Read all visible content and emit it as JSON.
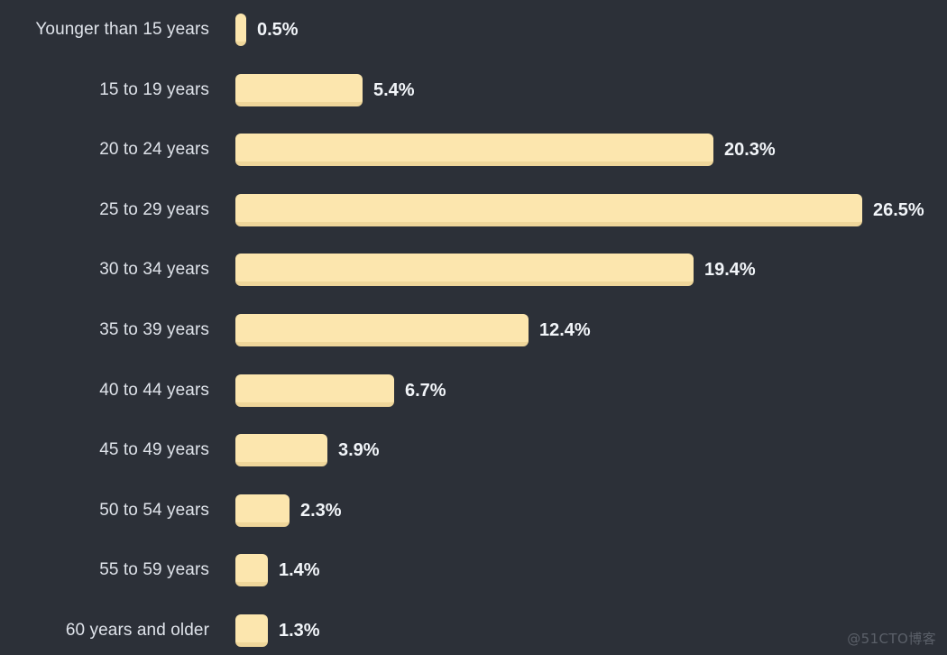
{
  "theme": {
    "background": "#2c3038",
    "bar_fill": "#fce6ae",
    "bar_shadow": "#efd69a",
    "category_label_color": "#dfe3ea",
    "value_label_color": "#f2f5f9",
    "watermark_color": "#5b6069"
  },
  "watermark": "@51CTO博客",
  "chart_data": {
    "type": "bar",
    "orientation": "horizontal",
    "title": "",
    "subtitle": "",
    "xlabel": "",
    "ylabel": "",
    "grid": false,
    "legend": false,
    "xlim": [
      0,
      26.5
    ],
    "unit": "%",
    "categories": [
      "Younger than 15 years",
      "15 to 19 years",
      "20 to 24 years",
      "25 to 29 years",
      "30 to 34 years",
      "35 to 39 years",
      "40 to 44 years",
      "45 to 49 years",
      "50 to 54 years",
      "55 to 59 years",
      "60 years and older"
    ],
    "values": [
      0.5,
      5.4,
      20.3,
      26.5,
      19.4,
      12.4,
      6.7,
      3.9,
      2.3,
      1.4,
      1.3
    ],
    "value_labels": [
      "0.5%",
      "5.4%",
      "20.3%",
      "26.5%",
      "19.4%",
      "12.4%",
      "6.7%",
      "3.9%",
      "2.3%",
      "1.4%",
      "1.3%"
    ],
    "bar_pixel_widths": [
      12,
      141,
      530,
      695,
      508,
      325,
      176,
      102,
      60,
      36,
      36
    ]
  }
}
